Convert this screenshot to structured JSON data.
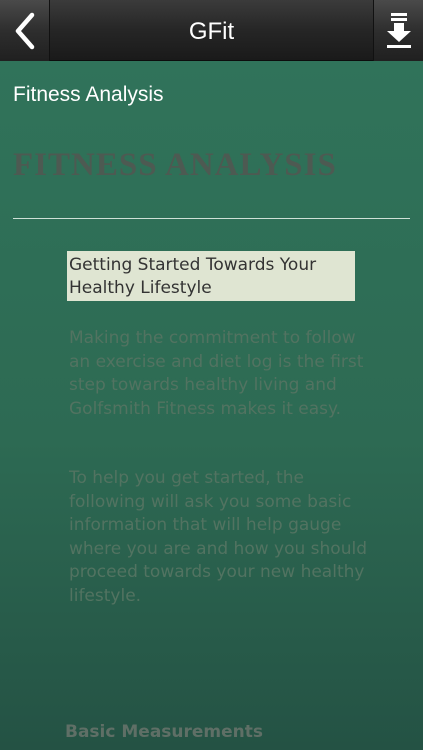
{
  "navbar": {
    "title": "GFit",
    "back_icon": "chevron-left-icon",
    "download_icon": "download-icon"
  },
  "page": {
    "section_label": "Fitness Analysis",
    "heading": "FITNESS ANALYSIS",
    "highlight_lines": [
      "Getting Started Towards Your",
      "Healthy Lifestyle"
    ],
    "paragraph1": "Making the commitment to follow an exercise and diet log is the first step towards healthy living and Golfsmith Fitness makes it easy.",
    "paragraph2": "To help you get started, the following will ask you some basic information that will help gauge where you are and how you should proceed towards your new healthy lifestyle.",
    "subheading": "Basic Measurements"
  },
  "colors": {
    "navbar": "#262626",
    "background": "#2f6c55",
    "highlight_bg": "#dfe5d2",
    "heading": "#4d5a52"
  }
}
